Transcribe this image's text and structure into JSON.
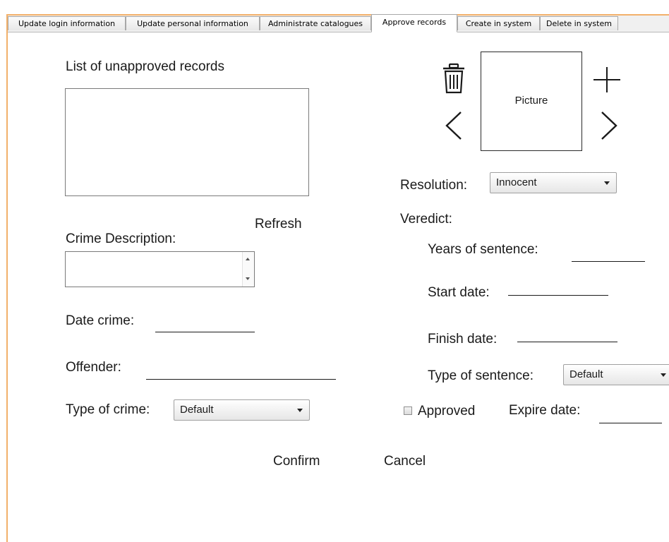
{
  "tabs": [
    {
      "label": "Update login information"
    },
    {
      "label": "Update personal information"
    },
    {
      "label": "Administrate catalogues"
    },
    {
      "label": "Approve records",
      "active": true
    },
    {
      "label": "Create in system"
    },
    {
      "label": "Delete in system"
    }
  ],
  "list": {
    "label": "List of unapproved records",
    "refresh_label": "Refresh"
  },
  "crime": {
    "description_label": "Crime Description:",
    "date_label": "Date crime:",
    "offender_label": "Offender:",
    "type_label": "Type of crime:",
    "type_value": "Default"
  },
  "picture": {
    "label": "Picture",
    "icons": [
      "trash-icon",
      "plus-icon",
      "chevron-left-icon",
      "chevron-right-icon"
    ]
  },
  "resolution": {
    "label": "Resolution:",
    "value": "Innocent"
  },
  "verdict": {
    "label": "Veredict:",
    "years_label": "Years of sentence:",
    "start_label": "Start date:",
    "finish_label": "Finish date:",
    "type_label": "Type of sentence:",
    "type_value": "Default"
  },
  "approval": {
    "approved_label": "Approved",
    "expire_label": "Expire date:"
  },
  "actions": {
    "confirm_label": "Confirm",
    "cancel_label": "Cancel"
  },
  "colors": {
    "frame_border": "#f2b06a",
    "tab_bar": "#f0f0f0",
    "background": "#ffffff"
  }
}
